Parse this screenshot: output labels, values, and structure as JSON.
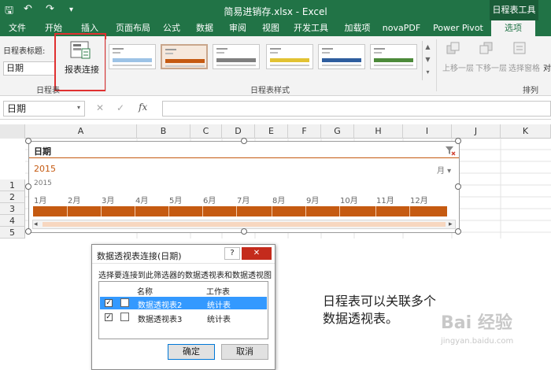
{
  "window": {
    "title": "简易进销存.xlsx - Excel",
    "contextual_group": "日程表工具",
    "qat": {
      "save": "🖫",
      "undo": "↶",
      "redo": "↷",
      "more": "▾"
    }
  },
  "tabs": [
    "文件",
    "开始",
    "插入",
    "页面布局",
    "公式",
    "数据",
    "审阅",
    "视图",
    "开发工具",
    "加载项",
    "novaPDF",
    "Power Pivot",
    "选项"
  ],
  "ribbon": {
    "caption_label": "日程表标题:",
    "caption_value": "日期",
    "report_connect_label": "报表连接",
    "group_timeline": "日程表",
    "group_styles": "日程表样式",
    "group_arrange": "排列",
    "bring_forward": "上移一层",
    "send_backward": "下移一层",
    "selection_pane": "选择窗格",
    "align": "对"
  },
  "formula_bar": {
    "name_box": "日期",
    "cancel": "✕",
    "enter": "✓",
    "fx": "fx"
  },
  "grid": {
    "columns": [
      "A",
      "B",
      "C",
      "D",
      "E",
      "F",
      "G",
      "H",
      "I",
      "J",
      "K"
    ],
    "rows": [
      "1",
      "2",
      "3",
      "4",
      "5"
    ]
  },
  "timeline": {
    "header": "日期",
    "selection_text": "2015",
    "level": "月 ▾",
    "year": "2015",
    "months": [
      "1月",
      "2月",
      "3月",
      "4月",
      "5月",
      "6月",
      "7月",
      "8月",
      "9月",
      "10月",
      "11月",
      "12月"
    ],
    "accent_color": "#c55a11",
    "left_arrow": "◂",
    "right_arrow": "▸"
  },
  "dialog": {
    "title": "数据透视表连接(日期)",
    "help": "?",
    "close": "✕",
    "instruction": "选择要连接到此筛选器的数据透视表和数据透视图",
    "col_name": "名称",
    "col_sheet": "工作表",
    "rows": [
      {
        "checked": "✓",
        "name": "数据透视表2",
        "sheet": "统计表"
      },
      {
        "checked": "✓",
        "name": "数据透视表3",
        "sheet": "统计表"
      }
    ],
    "ok": "确定",
    "cancel": "取消"
  },
  "caption": {
    "line1": "日程表可以关联多个",
    "line2": "数据透视表。"
  },
  "watermark": {
    "brand": "Bai 经验",
    "url": "jingyan.baidu.com"
  }
}
